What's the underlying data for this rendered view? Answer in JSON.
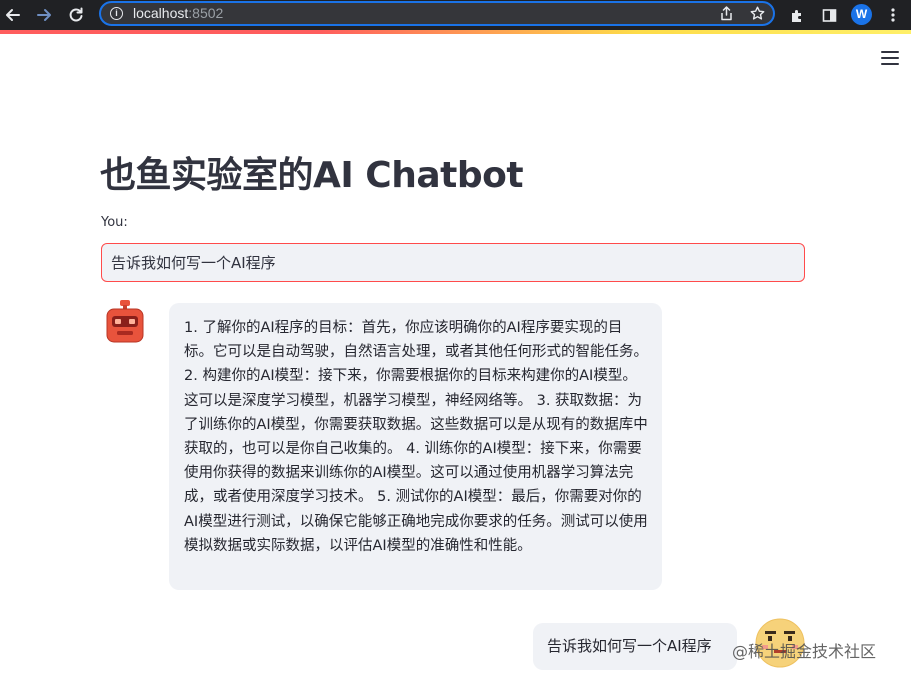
{
  "browser": {
    "url_host": "localhost",
    "url_port": ":8502",
    "profile_initial": "W",
    "icons": [
      "back-arrow-icon",
      "forward-arrow-icon",
      "reload-icon",
      "info-icon",
      "share-icon",
      "bookmark-star-icon",
      "extensions-icon",
      "sidebar-icon",
      "more-vert-icon"
    ]
  },
  "app": {
    "title": "也鱼实验室的AI Chatbot",
    "input_label": "You:",
    "input_value": "告诉我如何写一个AI程序",
    "menu_icon": "hamburger-menu-icon"
  },
  "messages": [
    {
      "role": "bot",
      "avatar": "robot-avatar-icon",
      "text": "1. 了解你的AI程序的目标：首先，你应该明确你的AI程序要实现的目标。它可以是自动驾驶，自然语言处理，或者其他任何形式的智能任务。 2. 构建你的AI模型：接下来，你需要根据你的目标来构建你的AI模型。这可以是深度学习模型，机器学习模型，神经网络等。 3. 获取数据：为了训练你的AI模型，你需要获取数据。这些数据可以是从现有的数据库中获取的，也可以是你自己收集的。 4. 训练你的AI模型：接下来，你需要使用你获得的数据来训练你的AI模型。这可以通过使用机器学习算法完成，或者使用深度学习技术。 5. 测试你的AI模型：最后，你需要对你的AI模型进行测试，以确保它能够正确地完成你要求的任务。测试可以使用模拟数据或实际数据，以评估AI模型的准确性和性能。"
    },
    {
      "role": "user",
      "avatar": "pixel-face-avatar-icon",
      "text": "告诉我如何写一个AI程序"
    }
  ],
  "watermark": "@稀土掘金技术社区",
  "colors": {
    "accent": "#ff4b4b",
    "bubble": "#f0f2f6",
    "chrome": "#202124",
    "focus_ring": "#1a73e8"
  }
}
